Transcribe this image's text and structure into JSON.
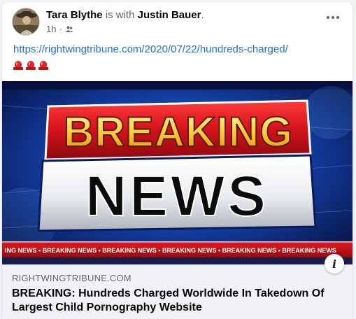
{
  "post": {
    "author": "Tara Blythe",
    "with_text": "is with",
    "tagged": "Justin Bauer",
    "tagged_suffix": ".",
    "time": "1h",
    "audience_icon": "friends-icon",
    "more_icon": "more-horizontal-icon",
    "link_url": "https://rightwingtribune.com/2020/07/22/hundreds-charged/",
    "emoji": [
      "police-light-emoji",
      "police-light-emoji",
      "police-light-emoji"
    ]
  },
  "media": {
    "line1": "BREAKING",
    "line2": "NEWS",
    "ticker": "ING NEWS • BREAKING NEWS • BREAKING NEWS • BREAKING NEWS • BREAKING NEWS • BREAKING NEWS",
    "colors": {
      "red": "#d3121b",
      "blue": "#0a1a5c",
      "silver": "#e9ecef"
    }
  },
  "link_preview": {
    "domain": "RIGHTWINGTRIBUNE.COM",
    "title": "BREAKING: Hundreds Charged Worldwide In Takedown Of Largest Child Pornography Website",
    "info_icon": "info-icon"
  }
}
